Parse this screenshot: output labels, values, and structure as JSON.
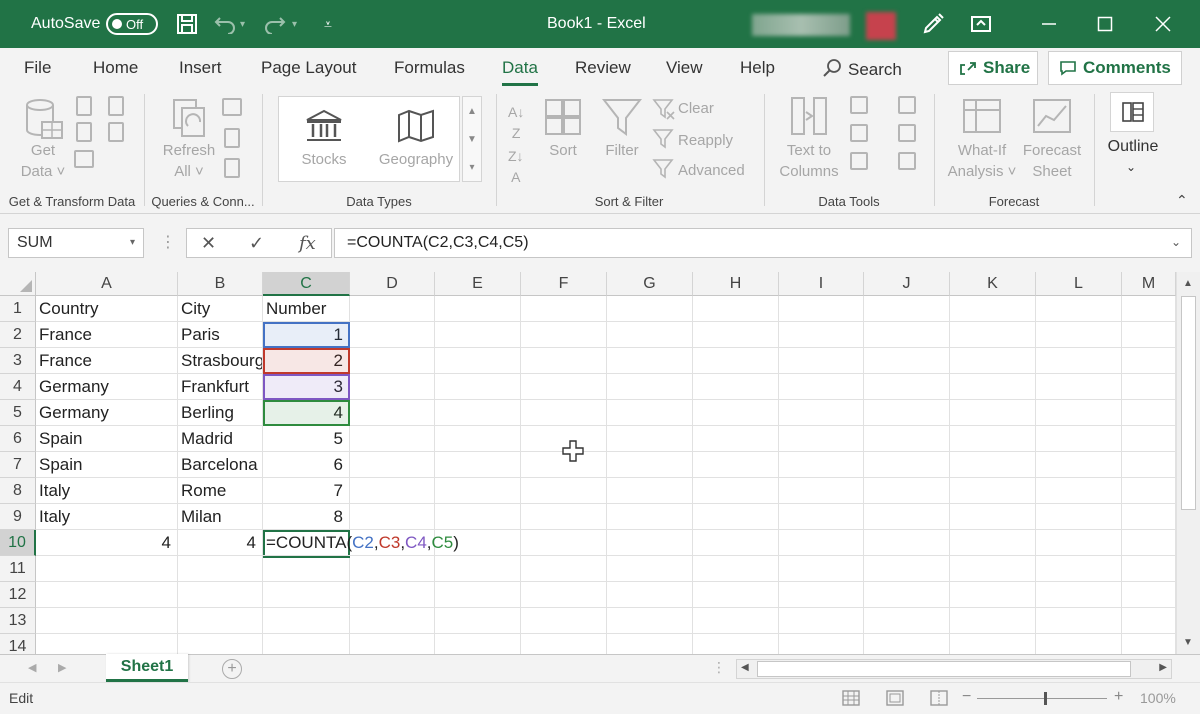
{
  "titlebar": {
    "autosave_label": "AutoSave",
    "autosave_state": "Off",
    "title": "Book1  -  Excel"
  },
  "tabs": [
    "File",
    "Home",
    "Insert",
    "Page Layout",
    "Formulas",
    "Data",
    "Review",
    "View",
    "Help"
  ],
  "active_tab": "Data",
  "search_label": "Search",
  "share_label": "Share",
  "comments_label": "Comments",
  "ribbon": {
    "get_data": [
      "Get",
      "Data ˅"
    ],
    "refresh_all": [
      "Refresh",
      "All ˅"
    ],
    "stocks": "Stocks",
    "geography": "Geography",
    "sort": "Sort",
    "filter": "Filter",
    "clear": "Clear",
    "reapply": "Reapply",
    "advanced": "Advanced",
    "text_to_columns": [
      "Text to",
      "Columns"
    ],
    "what_if": [
      "What-If",
      "Analysis ˅"
    ],
    "forecast_sheet": [
      "Forecast",
      "Sheet"
    ],
    "outline": "Outline",
    "groups": [
      "Get & Transform Data",
      "Queries & Conn...",
      "Data Types",
      "Sort & Filter",
      "Data Tools",
      "Forecast"
    ]
  },
  "formula_bar": {
    "name_box": "SUM",
    "formula": "=COUNTA(C2,C3,C4,C5)"
  },
  "grid": {
    "columns": [
      "A",
      "B",
      "C",
      "D",
      "E",
      "F",
      "G",
      "H",
      "I",
      "J",
      "K",
      "L",
      "M"
    ],
    "row_numbers": [
      "1",
      "2",
      "3",
      "4",
      "5",
      "6",
      "7",
      "8",
      "9",
      "10",
      "11",
      "12",
      "13",
      "14"
    ],
    "rows": [
      [
        "Country",
        "City",
        "Number"
      ],
      [
        "France",
        "Paris",
        "1"
      ],
      [
        "France",
        "Strasbourg",
        "2"
      ],
      [
        "Germany",
        "Frankfurt",
        "3"
      ],
      [
        "Germany",
        "Berling",
        "4"
      ],
      [
        "Spain",
        "Madrid",
        "5"
      ],
      [
        "Spain",
        "Barcelona",
        "6"
      ],
      [
        "Italy",
        "Rome",
        "7"
      ],
      [
        "Italy",
        "Milan",
        "8"
      ]
    ],
    "row10": {
      "a": "4",
      "b": "4",
      "formula_parts": [
        "=COUNTA(",
        "C2",
        ",",
        "C3",
        ",",
        "C4",
        ",",
        "C5",
        ")"
      ]
    }
  },
  "ref_colors": {
    "c2": "#4472c4",
    "c3": "#c0392b",
    "c4": "#7e57c2",
    "c5": "#2e8b3e"
  },
  "sheet_tab": "Sheet1",
  "status": {
    "mode": "Edit",
    "zoom": "100%",
    "zoom_minus": "−",
    "zoom_plus": "+"
  }
}
